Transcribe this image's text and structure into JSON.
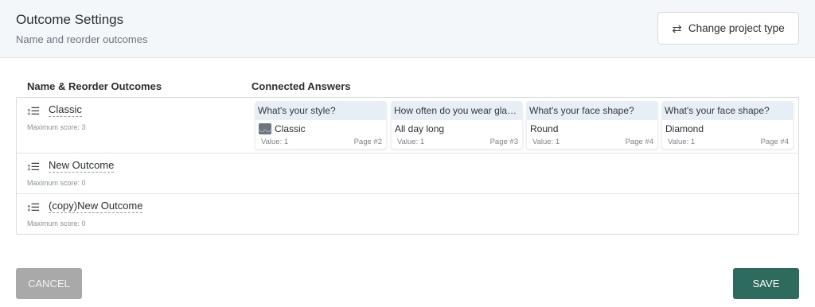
{
  "header": {
    "title": "Outcome Settings",
    "subtitle": "Name and reorder outcomes",
    "change_button_label": "Change project type",
    "change_button_icon": "swap-arrows-icon"
  },
  "columns": {
    "left": "Name & Reorder Outcomes",
    "right": "Connected Answers"
  },
  "outcomes": [
    {
      "name": "Classic",
      "max_score": "Maximum score: 3",
      "answers": [
        {
          "question": "What's your style?",
          "answer": "Classic",
          "has_thumb": true,
          "value": "Value: 1",
          "page": "Page #2"
        },
        {
          "question": "How often do you wear glas...",
          "answer": "All day long",
          "has_thumb": false,
          "value": "Value: 1",
          "page": "Page #3"
        },
        {
          "question": "What's your face shape?",
          "answer": "Round",
          "has_thumb": false,
          "value": "Value: 1",
          "page": "Page #4"
        },
        {
          "question": "What's your face shape?",
          "answer": "Diamond",
          "has_thumb": false,
          "value": "Value: 1",
          "page": "Page #4"
        }
      ]
    },
    {
      "name": "New Outcome",
      "max_score": "Maximum score: 0",
      "answers": []
    },
    {
      "name": "(copy)New Outcome",
      "max_score": "Maximum score: 0",
      "answers": []
    }
  ],
  "footer": {
    "cancel_label": "CANCEL",
    "save_label": "SAVE"
  },
  "colors": {
    "save": "#2d6b5f",
    "cancel": "#a9a9a9",
    "header_bg": "#f4f7fa",
    "card_header_bg": "#e8eef5"
  }
}
